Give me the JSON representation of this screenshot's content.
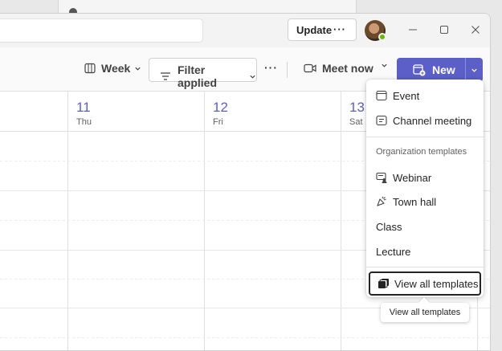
{
  "titlebar": {
    "update_label": "Update",
    "more_label": "···"
  },
  "toolbar": {
    "view_label": "Week",
    "filter_label": "Filter applied",
    "more_label": "···",
    "meet_now_label": "Meet now",
    "new_label": "New"
  },
  "calendar": {
    "days": [
      {
        "num": "11",
        "name": "Thu"
      },
      {
        "num": "12",
        "name": "Fri"
      },
      {
        "num": "13",
        "name": "Sat"
      }
    ]
  },
  "new_menu": {
    "items": [
      {
        "label": "Event",
        "icon": "calendar-icon"
      },
      {
        "label": "Channel meeting",
        "icon": "channel-meeting-icon"
      }
    ],
    "section_header": "Organization templates",
    "templates": [
      {
        "label": "Webinar",
        "icon": "webinar-icon"
      },
      {
        "label": "Town hall",
        "icon": "town-hall-icon"
      },
      {
        "label": "Class",
        "icon": ""
      },
      {
        "label": "Lecture",
        "icon": ""
      }
    ],
    "view_all_label": "View all templates"
  },
  "tooltip": {
    "text": "View all templates"
  },
  "colors": {
    "accent": "#5b5fc7",
    "presence": "#6bb700"
  }
}
